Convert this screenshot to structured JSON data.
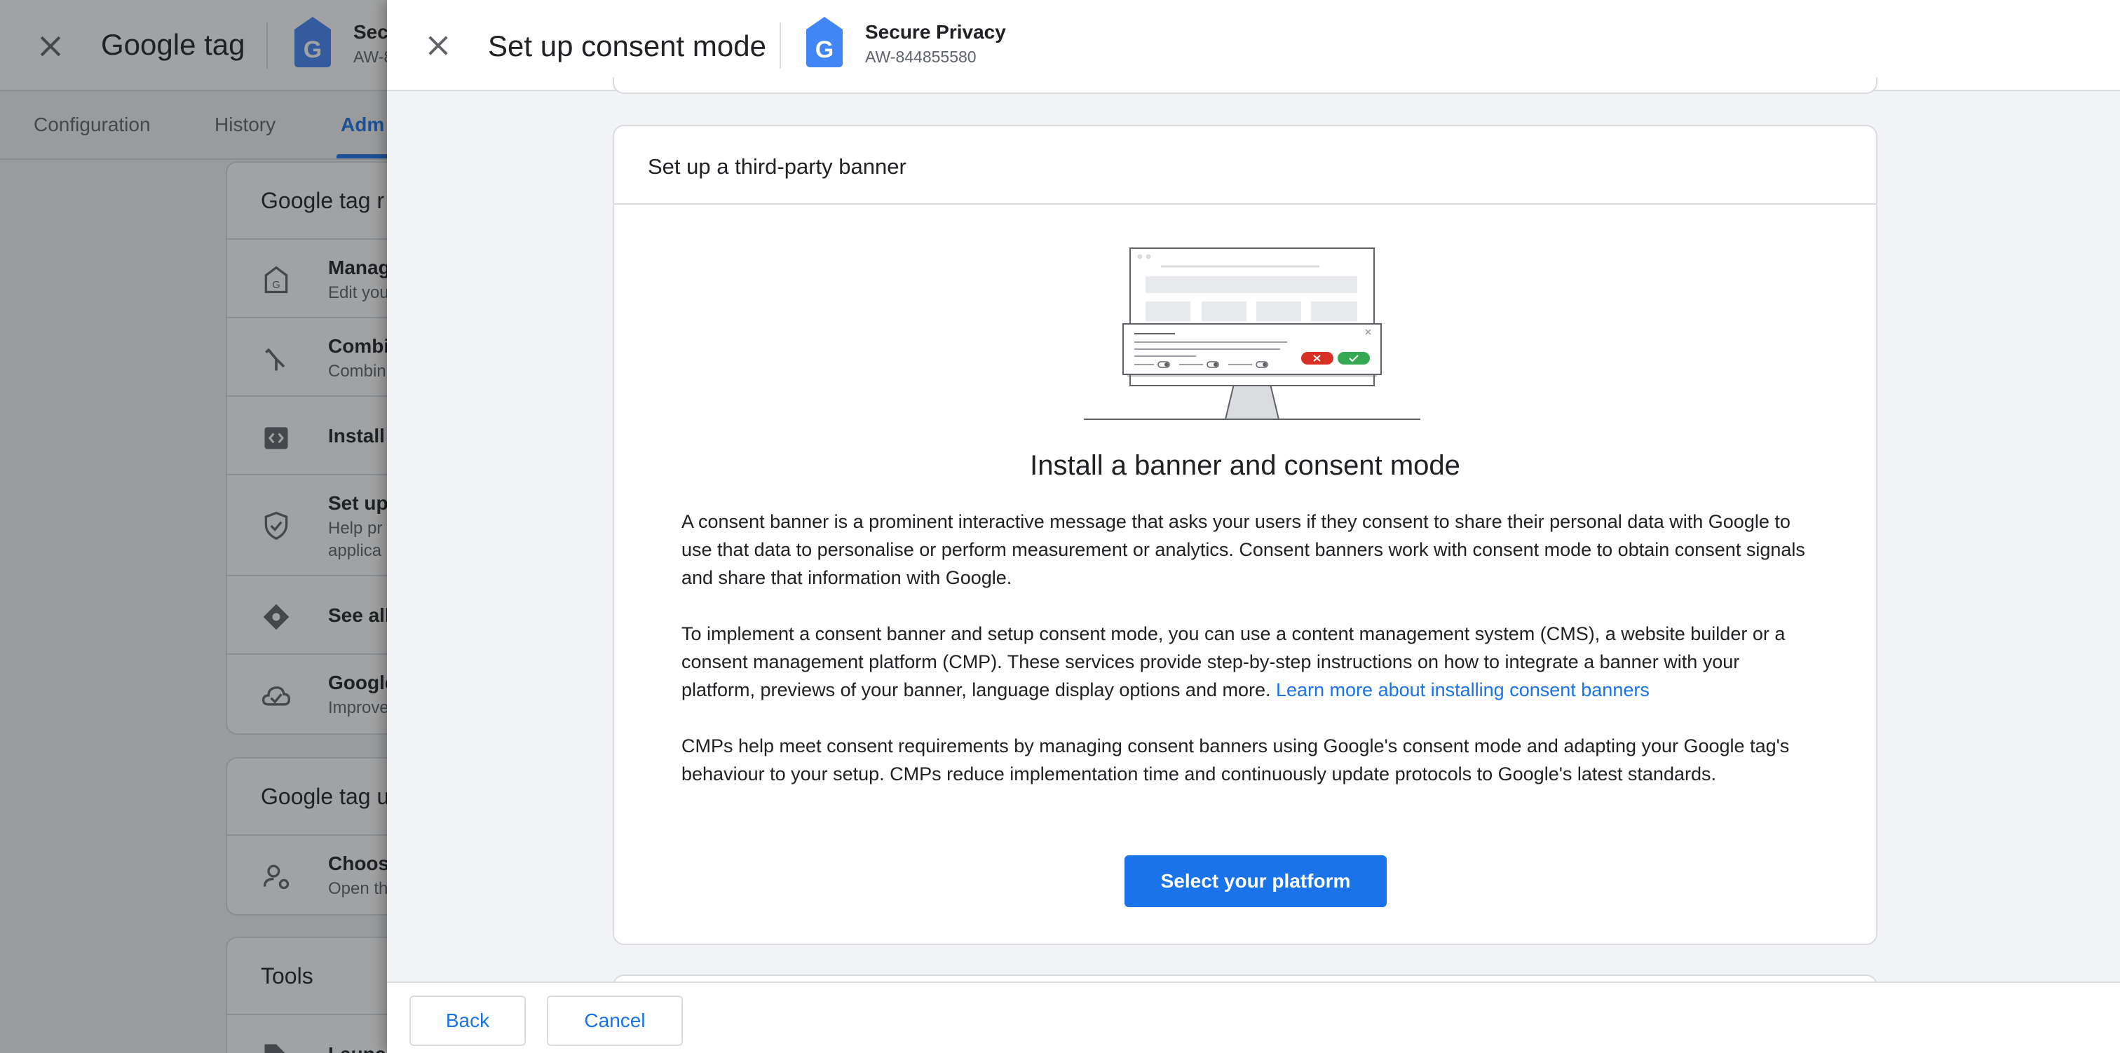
{
  "background_page": {
    "title": "Google tag",
    "account": {
      "name": "Sec",
      "id": "AW-8"
    },
    "tabs": [
      "Configuration",
      "History",
      "Adm"
    ],
    "sections": [
      {
        "title": "Google tag r",
        "items": [
          {
            "title": "Manag",
            "subtitle": "Edit you",
            "icon": "tag-icon"
          },
          {
            "title": "Combi",
            "subtitle": "Combin",
            "icon": "merge-icon"
          },
          {
            "title": "Install",
            "icon": "code-icon"
          },
          {
            "title": "Set up",
            "subtitle": "Help pr",
            "subtitle2": "applica",
            "icon": "shield-icon"
          },
          {
            "title": "See all",
            "icon": "diamond-icon"
          },
          {
            "title": "Google",
            "subtitle": "Improve",
            "icon": "cloud-check-icon"
          }
        ]
      },
      {
        "title": "Google tag u",
        "items": [
          {
            "title": "Choos",
            "subtitle": "Open th",
            "icon": "user-settings-icon"
          }
        ]
      },
      {
        "title": "Tools",
        "items": [
          {
            "title": "Launch",
            "icon": "tag-outline-icon"
          }
        ]
      }
    ]
  },
  "panel": {
    "title": "Set up consent mode",
    "account": {
      "name": "Secure Privacy",
      "id": "AW-844855580"
    },
    "card": {
      "title": "Set up a third-party banner",
      "heading": "Install a banner and consent mode",
      "paragraphs": [
        "A consent banner is a prominent interactive message that asks your users if they consent to share their personal data with Google to use that data to personalise or perform measurement or analytics. Consent banners work with consent mode to obtain consent signals and share that information with Google.",
        "To implement a consent banner and setup consent mode, you can use a content management system (CMS), a website builder or a consent management platform (CMP). These services provide step-by-step instructions on how to integrate a banner with your platform, previews of your banner, language display options and more. ",
        "CMPs help meet consent requirements by managing consent banners using Google's consent mode and adapting your Google tag's behaviour to your setup. CMPs reduce implementation time and continuously update protocols to Google's latest standards."
      ],
      "link_text": "Learn more about installing consent banners",
      "button_label": "Select your platform"
    },
    "footer": {
      "back_label": "Back",
      "cancel_label": "Cancel"
    }
  },
  "colors": {
    "accent": "#1a73e8",
    "deny": "#d93025",
    "accept": "#34a853"
  },
  "icons": {
    "close": "close-icon",
    "tag": "google-tag-icon"
  }
}
